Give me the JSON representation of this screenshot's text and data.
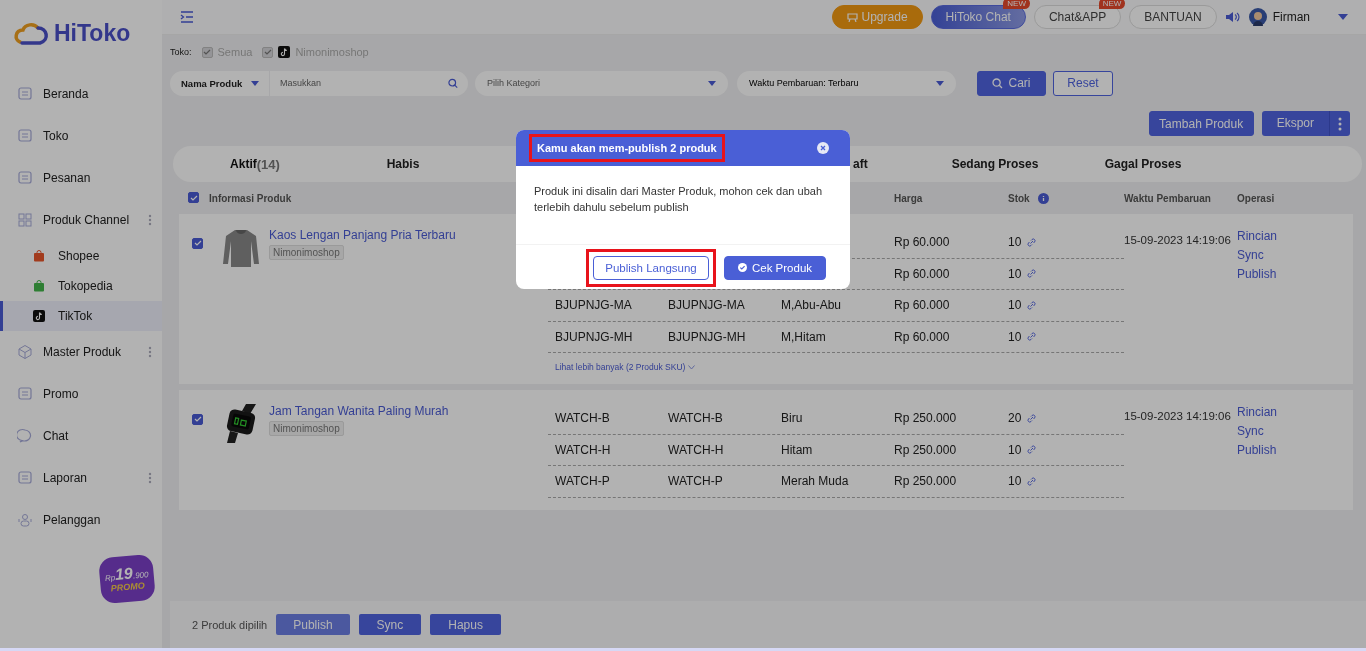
{
  "sidebar": {
    "logo": "HiToko",
    "items": [
      {
        "label": "Beranda",
        "selected": false,
        "has_menu": false
      },
      {
        "label": "Toko",
        "selected": false,
        "has_menu": false
      },
      {
        "label": "Pesanan",
        "selected": false,
        "has_menu": false
      },
      {
        "label": "Produk Channel",
        "selected": false,
        "has_menu": true,
        "children": [
          {
            "label": "Shopee",
            "selected": false
          },
          {
            "label": "Tokopedia",
            "selected": false
          },
          {
            "label": "TikTok",
            "selected": true
          }
        ]
      },
      {
        "label": "Master Produk",
        "selected": false,
        "has_menu": true
      },
      {
        "label": "Promo",
        "selected": false,
        "has_menu": false
      },
      {
        "label": "Chat",
        "selected": false,
        "has_menu": false
      },
      {
        "label": "Laporan",
        "selected": false,
        "has_menu": true
      },
      {
        "label": "Pelanggan",
        "selected": false,
        "has_menu": false
      }
    ],
    "promo_badge": {
      "price_prefix": "Rp",
      "price": "19",
      "price_suffix": ".900",
      "label": "PROMO"
    }
  },
  "topbar": {
    "buttons": [
      {
        "label": "Upgrade",
        "kind": "upgrade"
      },
      {
        "label": "HiToko Chat",
        "kind": "primary",
        "badge": "NEW"
      },
      {
        "label": "Chat&APP",
        "kind": "outline",
        "badge": "NEW"
      },
      {
        "label": "BANTUAN",
        "kind": "outline"
      }
    ],
    "user": "Firman"
  },
  "filters": {
    "toko_label": "Toko:",
    "stores": [
      {
        "label": "Semua",
        "checked": true,
        "disabled": true,
        "tiktok": false
      },
      {
        "label": "Nimonimoshop",
        "checked": true,
        "disabled": true,
        "tiktok": true
      }
    ],
    "field_select": "Nama Produk",
    "search": {
      "placeholder": "Masukkan"
    },
    "category": {
      "placeholder": "Pilih Kategori"
    },
    "sort": "Waktu Pembaruan: Terbaru",
    "search_button": "Cari",
    "reset_button": "Reset"
  },
  "actions": {
    "add": "Tambah Produk",
    "export": "Ekspor"
  },
  "tabs": [
    {
      "label": "Aktif",
      "count": "(14)",
      "selected": true,
      "kind": "full"
    },
    {
      "label": "Habis",
      "selected": false,
      "kind": "full"
    },
    {
      "label": "aft",
      "selected": false,
      "kind": "cut"
    },
    {
      "label": "Sedang Proses",
      "selected": false,
      "kind": "full"
    },
    {
      "label": "Gagal Proses",
      "selected": false,
      "kind": "full"
    }
  ],
  "table": {
    "select_all": true,
    "columns": {
      "info": "Informasi Produk",
      "harga": "Harga",
      "stok": "Stok",
      "waktu": "Waktu Pembaruan",
      "operasi": "Operasi"
    },
    "rows": [
      {
        "checked": true,
        "name": "Kaos Lengan Panjang Pria Terbaru",
        "shop": "Nimonimoshop",
        "time": "15-09-2023 14:19:06",
        "operations": [
          "Rincian",
          "Sync",
          "Publish"
        ],
        "more": "Lihat lebih banyak (2 Produk SKU)",
        "variants": [
          {
            "harga": "Rp 60.000",
            "stok": "10"
          },
          {
            "harga": "Rp 60.000",
            "stok": "10"
          },
          {
            "sku": "BJUPNJG-MA",
            "sku_2": "BJUPNJG-MA",
            "variant": "M,Abu-Abu",
            "harga": "Rp 60.000",
            "stok": "10"
          },
          {
            "sku": "BJUPNJG-MH",
            "sku_2": "BJUPNJG-MH",
            "variant": "M,Hitam",
            "harga": "Rp 60.000",
            "stok": "10"
          }
        ]
      },
      {
        "checked": true,
        "name": "Jam Tangan Wanita Paling Murah",
        "shop": "Nimonimoshop",
        "time": "15-09-2023 14:19:06",
        "operations": [
          "Rincian",
          "Sync",
          "Publish"
        ],
        "variants": [
          {
            "sku": "WATCH-B",
            "sku_2": "WATCH-B",
            "variant": "Biru",
            "harga": "Rp 250.000",
            "stok": "20"
          },
          {
            "sku": "WATCH-H",
            "sku_2": "WATCH-H",
            "variant": "Hitam",
            "harga": "Rp 250.000",
            "stok": "10"
          },
          {
            "sku": "WATCH-P",
            "sku_2": "WATCH-P",
            "variant": "Merah Muda",
            "harga": "Rp 250.000",
            "stok": "10"
          }
        ]
      }
    ]
  },
  "bottom_bar": {
    "selected_text": "2 Produk dipilih",
    "buttons": [
      {
        "label": "Publish",
        "kind": "light"
      },
      {
        "label": "Sync",
        "kind": "dark"
      },
      {
        "label": "Hapus",
        "kind": "dark"
      }
    ]
  },
  "dialog": {
    "title": "Kamu akan mem-publish 2 produk",
    "title_highlighted": true,
    "message": "Produk ini disalin dari Master Produk, mohon cek dan ubah terlebih dahulu sebelum publish",
    "buttons": [
      {
        "label": "Publish Langsung",
        "kind": "outline",
        "highlighted": true
      },
      {
        "label": "Cek Produk",
        "kind": "primary",
        "highlighted": false
      }
    ]
  }
}
